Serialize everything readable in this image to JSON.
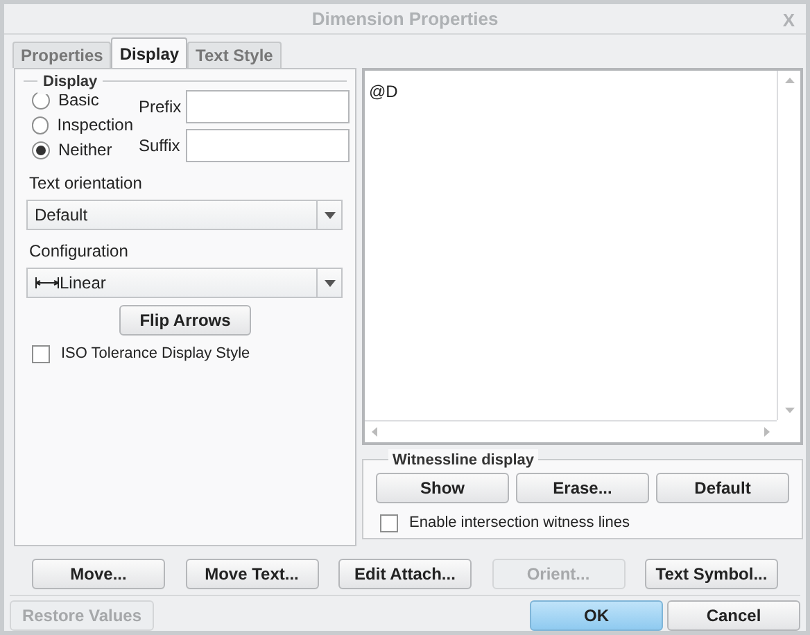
{
  "window": {
    "title": "Dimension Properties",
    "close": "X"
  },
  "tabs": [
    {
      "label": "Properties",
      "selected": false
    },
    {
      "label": "Display",
      "selected": true
    },
    {
      "label": "Text Style",
      "selected": false
    }
  ],
  "display_group": {
    "title": "Display",
    "options": [
      {
        "label": "Basic",
        "selected": false
      },
      {
        "label": "Inspection",
        "selected": false
      },
      {
        "label": "Neither",
        "selected": true
      }
    ],
    "fields": [
      {
        "label": "Prefix"
      },
      {
        "label": "Suffix"
      }
    ]
  },
  "text_orientation": {
    "label": "Text orientation",
    "value": "Default"
  },
  "configuration": {
    "label": "Configuration",
    "value": "Linear"
  },
  "flip_button": "Flip Arrows",
  "iso_checkbox": {
    "label": "ISO Tolerance Display Style",
    "checked": false
  },
  "text_area": {
    "value": "@D"
  },
  "witnessline": {
    "title": "Witnessline display",
    "buttons": [
      "Show",
      "Erase...",
      "Default"
    ],
    "checkbox": {
      "label": "Enable intersection witness lines",
      "checked": false
    }
  },
  "action_buttons": [
    {
      "label": "Move...",
      "disabled": false
    },
    {
      "label": "Move Text...",
      "disabled": false
    },
    {
      "label": "Edit Attach...",
      "disabled": false
    },
    {
      "label": "Orient...",
      "disabled": true
    },
    {
      "label": "Text Symbol...",
      "disabled": false
    }
  ],
  "footer_buttons": [
    {
      "label": "Restore Values",
      "disabled": true,
      "primary": false
    },
    {
      "label": "OK",
      "disabled": false,
      "primary": true
    },
    {
      "label": "Cancel",
      "disabled": false,
      "primary": false
    }
  ]
}
